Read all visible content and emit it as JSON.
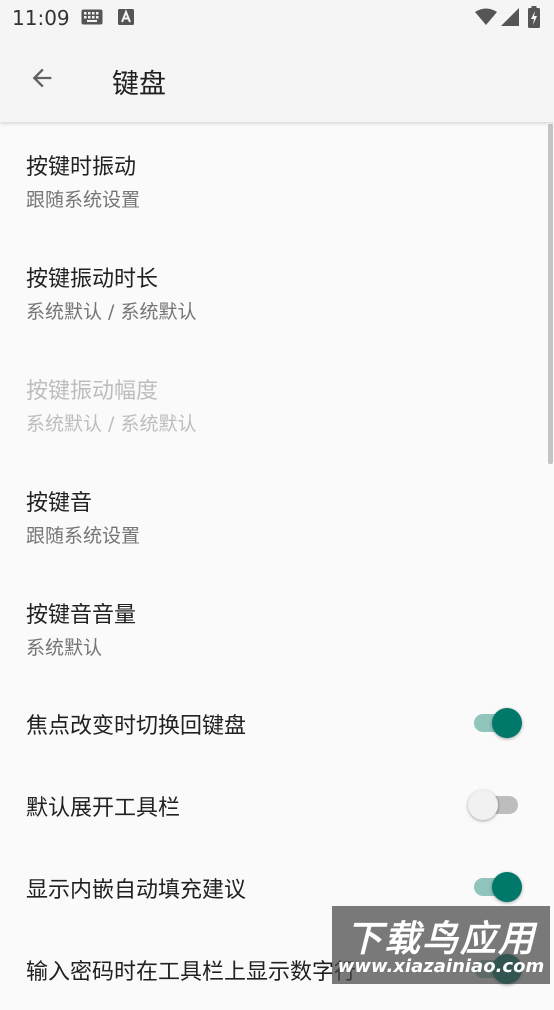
{
  "status_bar": {
    "time": "11:09",
    "icons": [
      "keyboard-icon",
      "a-letter-icon",
      "wifi-icon",
      "signal-icon",
      "battery-charging-icon"
    ]
  },
  "app_bar": {
    "title": "键盘",
    "back_icon": "arrow-left-icon"
  },
  "preferences": [
    {
      "title": "按键时振动",
      "summary": "跟随系统设置",
      "enabled": true
    },
    {
      "title": "按键振动时长",
      "summary": "系统默认 / 系统默认",
      "enabled": true
    },
    {
      "title": "按键振动幅度",
      "summary": "系统默认 / 系统默认",
      "enabled": false
    },
    {
      "title": "按键音",
      "summary": "跟随系统设置",
      "enabled": true
    },
    {
      "title": "按键音音量",
      "summary": "系统默认",
      "enabled": true
    }
  ],
  "switches": [
    {
      "title": "焦点改变时切换回键盘",
      "checked": true
    },
    {
      "title": "默认展开工具栏",
      "checked": false
    },
    {
      "title": "显示内嵌自动填充建议",
      "checked": true
    },
    {
      "title": "输入密码时在工具栏上显示数字行",
      "checked": true
    }
  ],
  "watermark": {
    "main": "下载鸟应用",
    "sub": "www.xiazainiao.com"
  },
  "colors": {
    "accent": "#00796b",
    "accent_track": "#8fc5bd",
    "background": "#fafafa",
    "bar": "#f5f5f5"
  }
}
